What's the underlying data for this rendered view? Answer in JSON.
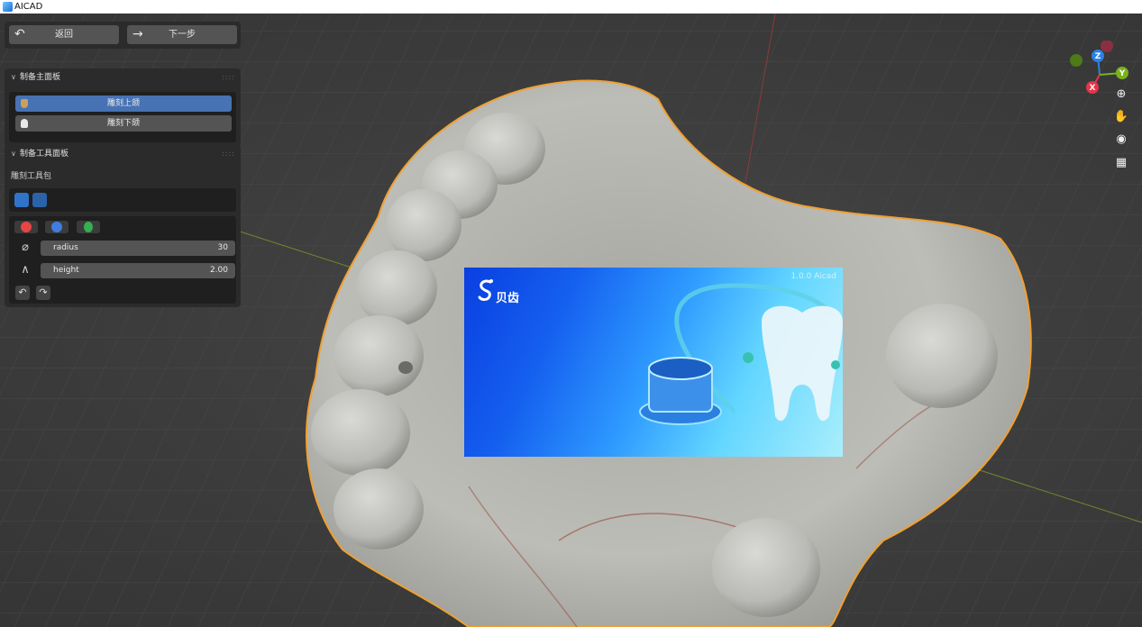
{
  "window": {
    "title": "AICAD"
  },
  "nav": {
    "back_label": "返回",
    "next_label": "下一步"
  },
  "main_panel": {
    "title": "制备主面板",
    "items": [
      {
        "label": "雕刻上颌",
        "active": true
      },
      {
        "label": "雕刻下颌",
        "active": false
      }
    ]
  },
  "tool_panel": {
    "title": "制备工具面板",
    "section_label": "雕刻工具包",
    "fields": [
      {
        "name": "radius",
        "value": "30"
      },
      {
        "name": "height",
        "value": "2.00"
      }
    ]
  },
  "gizmo": {
    "x_label": "X",
    "y_label": "Y",
    "z_label": "Z",
    "colors": {
      "x": "#e8334a",
      "y": "#7ab21d",
      "z": "#2e80e6"
    }
  },
  "viewport_tools": [
    "zoom-icon",
    "pan-hand-icon",
    "camera-icon",
    "grid-view-icon"
  ],
  "splash": {
    "brand": "贝齿",
    "version": "1.0.0 Aicad"
  },
  "colors": {
    "accent": "#4772b3",
    "panel": "#2b2b2b",
    "highlight_outline": "#f0a030"
  }
}
